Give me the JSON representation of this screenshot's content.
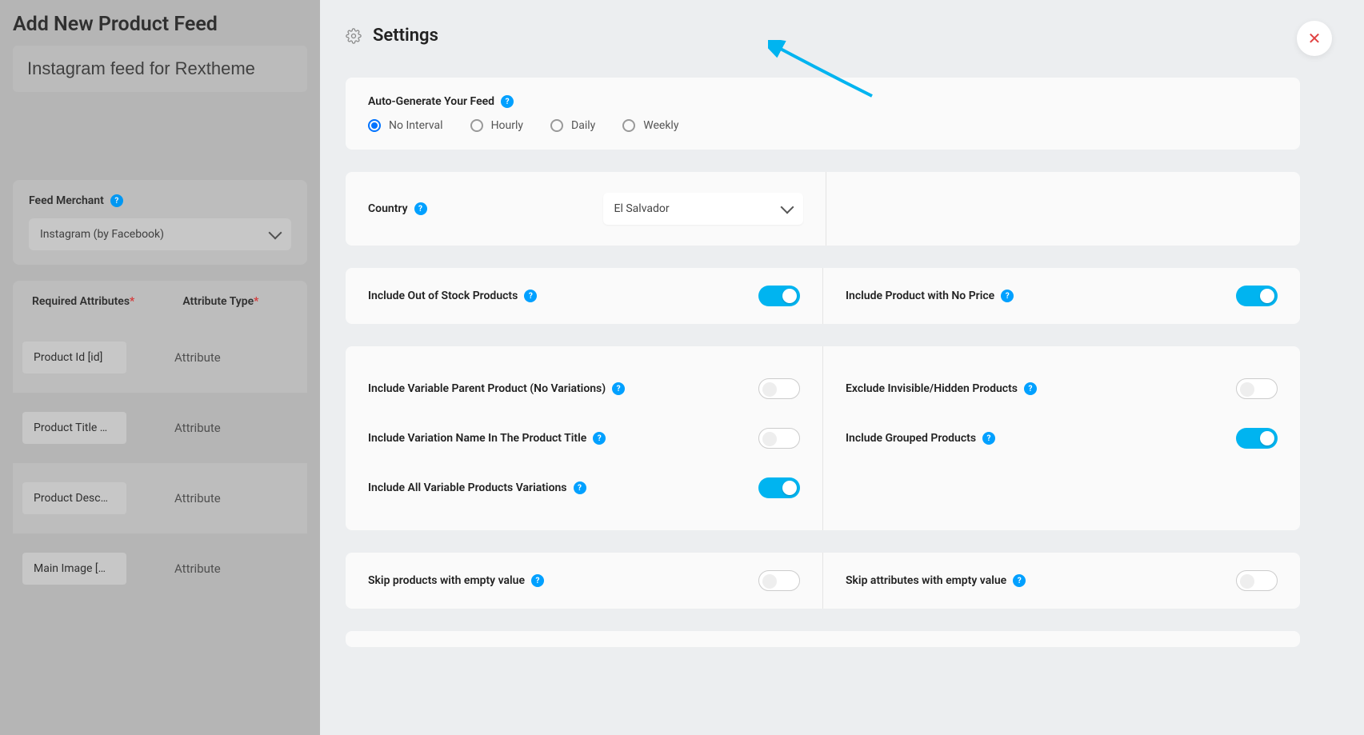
{
  "left": {
    "page_title": "Add New Product Feed",
    "title_value": "Instagram feed for Rextheme",
    "merchant_label": "Feed Merchant",
    "merchant_value": "Instagram (by Facebook)",
    "attr_head_required": "Required Attributes",
    "attr_head_type": "Attribute Type",
    "attrs": [
      {
        "name": "Product Id [id]",
        "type": "Attribute"
      },
      {
        "name": "Product Title …",
        "type": "Attribute"
      },
      {
        "name": "Product Desc…",
        "type": "Attribute"
      },
      {
        "name": "Main Image […",
        "type": "Attribute"
      }
    ]
  },
  "settings": {
    "title": "Settings",
    "autogen_label": "Auto-Generate Your Feed",
    "intervals": [
      "No Interval",
      "Hourly",
      "Daily",
      "Weekly"
    ],
    "interval_selected": "No Interval",
    "country_label": "Country",
    "country_value": "El Salvador",
    "toggles_left_a": [
      {
        "label": "Include Out of Stock Products",
        "on": true
      }
    ],
    "toggles_right_a": [
      {
        "label": "Include Product with No Price",
        "on": true
      }
    ],
    "toggles_left_b": [
      {
        "label": "Include Variable Parent Product (No Variations)",
        "on": false
      },
      {
        "label": "Include Variation Name In The Product Title",
        "on": false
      },
      {
        "label": "Include All Variable Products Variations",
        "on": true
      }
    ],
    "toggles_right_b": [
      {
        "label": "Exclude Invisible/Hidden Products",
        "on": false
      },
      {
        "label": "Include Grouped Products",
        "on": true
      }
    ],
    "toggles_left_c": [
      {
        "label": "Skip products with empty value",
        "on": false
      }
    ],
    "toggles_right_c": [
      {
        "label": "Skip attributes with empty value",
        "on": false
      }
    ]
  }
}
